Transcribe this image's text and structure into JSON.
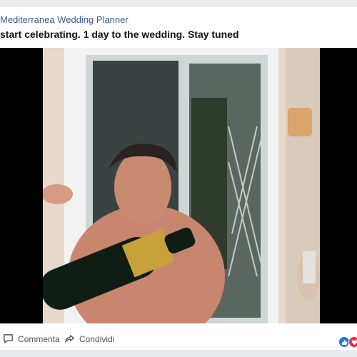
{
  "post": {
    "page_name": "Mediterranea Wedding Planner",
    "caption": "start celebrating. 1 day to the wedding. Stay tuned"
  },
  "video": {
    "description_icon": "video-frame"
  },
  "actions": {
    "comment_label": "Commenta",
    "share_label": "Condividi"
  },
  "reactions": {
    "icons": [
      "like-icon",
      "love-icon"
    ],
    "colors": {
      "like": "#1877f2",
      "love": "#f0284a"
    }
  },
  "colors": {
    "page_name": "#385898",
    "background": "#e9ebee"
  }
}
